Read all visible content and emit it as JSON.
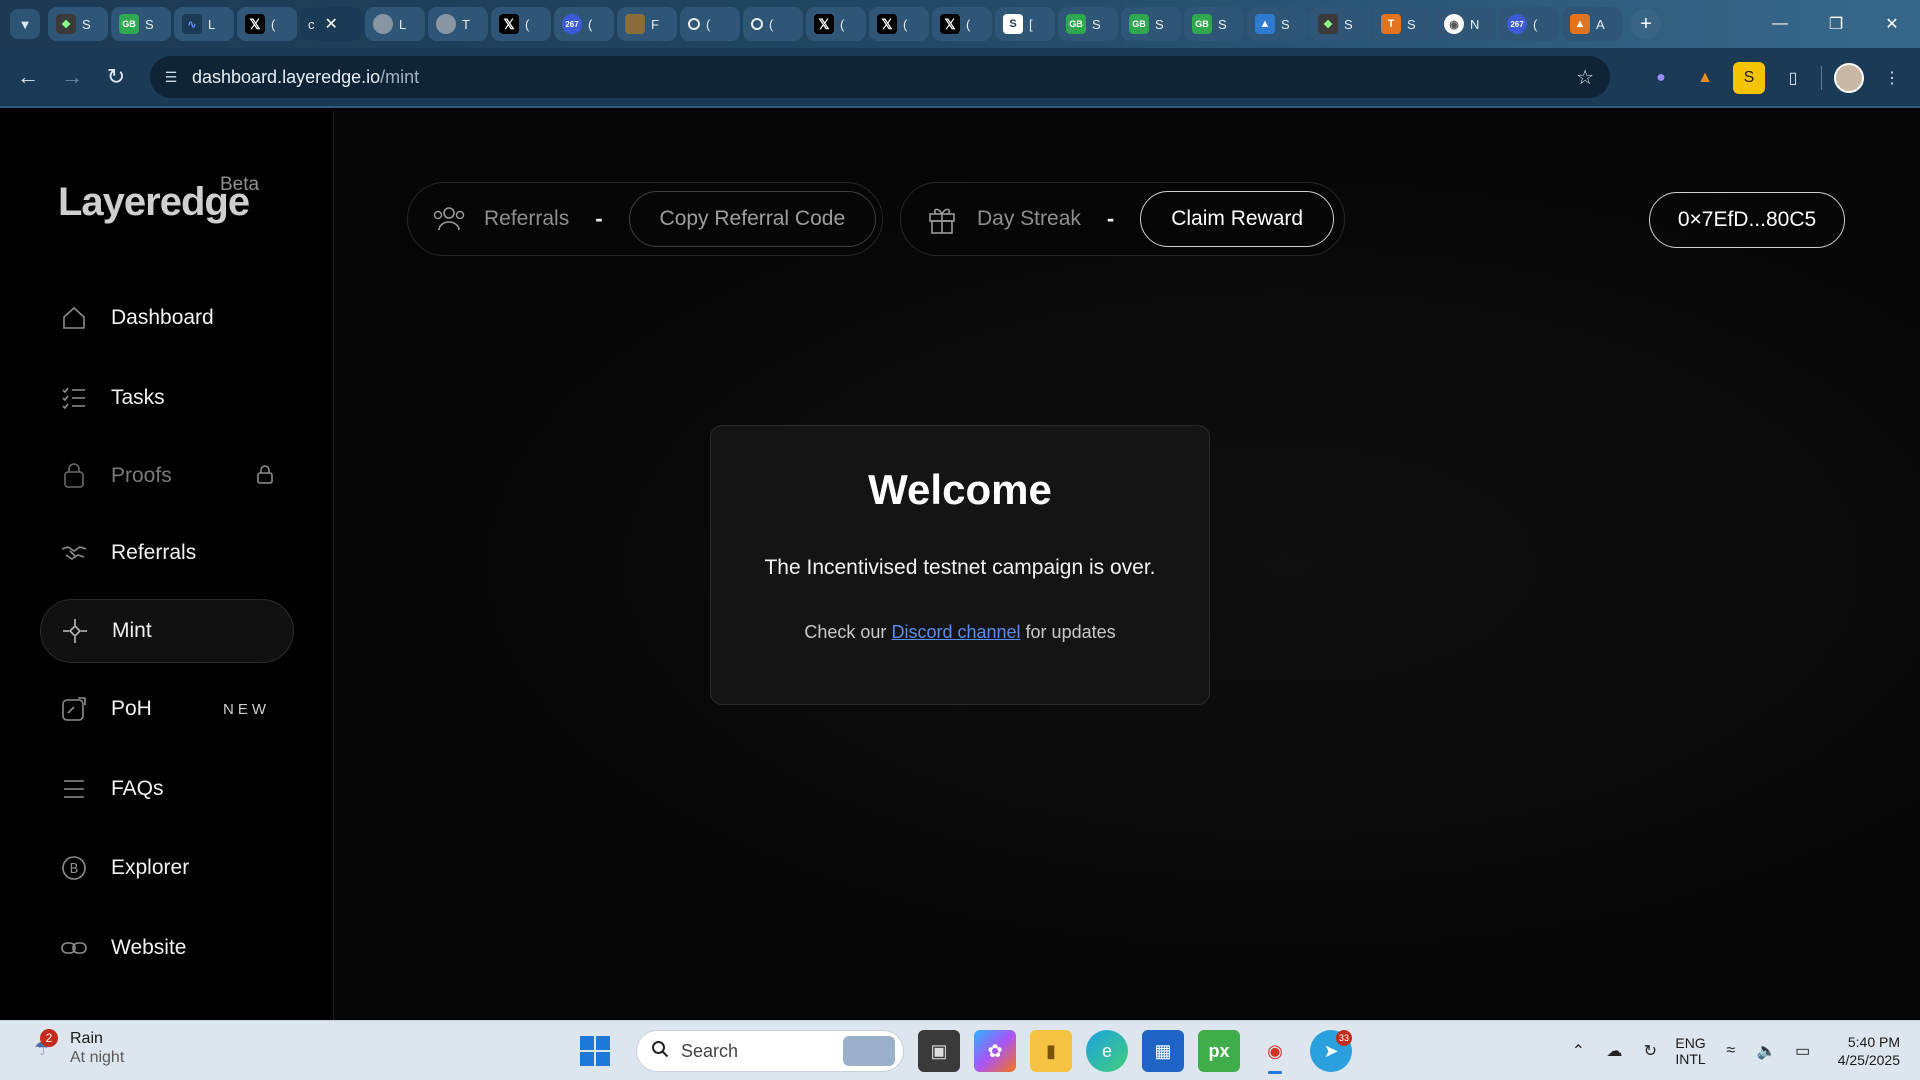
{
  "browser": {
    "tabs": [
      {
        "favicon": "gecko-icon",
        "text": "S"
      },
      {
        "favicon": "gb-icon",
        "text": "S"
      },
      {
        "favicon": "ai-icon",
        "text": "L"
      },
      {
        "favicon": "x-icon",
        "text": "("
      },
      {
        "favicon": "active",
        "text": "c"
      },
      {
        "favicon": "globe-icon",
        "text": "L"
      },
      {
        "favicon": "globe-icon",
        "text": "T"
      },
      {
        "favicon": "x-icon",
        "text": "("
      },
      {
        "favicon": "267-icon",
        "text": "("
      },
      {
        "favicon": "image-icon",
        "text": "F"
      },
      {
        "favicon": "circle-icon",
        "text": "("
      },
      {
        "favicon": "circle-icon",
        "text": "("
      },
      {
        "favicon": "x-icon",
        "text": "("
      },
      {
        "favicon": "x-icon",
        "text": "("
      },
      {
        "favicon": "x-icon",
        "text": "("
      },
      {
        "favicon": "s-icon",
        "text": "["
      },
      {
        "favicon": "gb-icon",
        "text": "S"
      },
      {
        "favicon": "gb-icon",
        "text": "S"
      },
      {
        "favicon": "gb-icon",
        "text": "S"
      },
      {
        "favicon": "shield-icon",
        "text": "S"
      },
      {
        "favicon": "gecko-icon",
        "text": "S"
      },
      {
        "favicon": "orange-icon",
        "text": "S"
      },
      {
        "favicon": "chrome-icon",
        "text": "N"
      },
      {
        "favicon": "267-icon",
        "text": "("
      },
      {
        "favicon": "orange-icon",
        "text": "A"
      }
    ],
    "url_host": "dashboard.layeredge.io",
    "url_path": "/mint"
  },
  "sidebar": {
    "logo": "Layeredge",
    "beta": "Beta",
    "items": [
      {
        "label": "Dashboard",
        "icon": "home-icon"
      },
      {
        "label": "Tasks",
        "icon": "checklist-icon"
      },
      {
        "label": "Proofs",
        "icon": "proof-icon"
      },
      {
        "label": "Referrals",
        "icon": "handshake-icon"
      },
      {
        "label": "Mint",
        "icon": "target-icon"
      },
      {
        "label": "PoH",
        "icon": "poh-icon",
        "badge": "NEW"
      },
      {
        "label": "FAQs",
        "icon": "menu-icon"
      },
      {
        "label": "Explorer",
        "icon": "bitcoin-icon"
      },
      {
        "label": "Website",
        "icon": "link-icon"
      }
    ]
  },
  "header": {
    "referrals_label": "Referrals",
    "referrals_value": "-",
    "copy_referral": "Copy Referral Code",
    "streak_label": "Day Streak",
    "streak_value": "-",
    "claim_reward": "Claim Reward",
    "wallet": "0×7EfD...80C5"
  },
  "modal": {
    "title": "Welcome",
    "message": "The Incentivised testnet campaign is over.",
    "sub_prefix": "Check our",
    "link": "Discord channel",
    "sub_suffix": "for updates"
  },
  "taskbar": {
    "weather_badge": "2",
    "weather_title": "Rain",
    "weather_sub": "At night",
    "search_placeholder": "Search",
    "telegram_badge": "33",
    "lang_1": "ENG",
    "lang_2": "INTL",
    "time": "5:40 PM",
    "date": "4/25/2025"
  },
  "colors": {
    "accent_link": "#5a8dee",
    "page_bg": "#050505",
    "chrome_bg": "#1b3a56"
  }
}
